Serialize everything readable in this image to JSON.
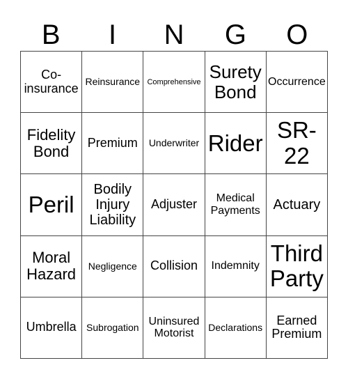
{
  "header": [
    "B",
    "I",
    "N",
    "G",
    "O"
  ],
  "cells": [
    [
      "Co-insurance",
      "Reinsurance",
      "Comprehensive",
      "Surety Bond",
      "Occurrence"
    ],
    [
      "Fidelity Bond",
      "Premium",
      "Underwriter",
      "Rider",
      "SR-22"
    ],
    [
      "Peril",
      "Bodily Injury Liability",
      "Adjuster",
      "Medical Payments",
      "Actuary"
    ],
    [
      "Moral Hazard",
      "Negligence",
      "Collision",
      "Indemnity",
      "Third Party"
    ],
    [
      "Umbrella",
      "Subrogation",
      "Uninsured Motorist",
      "Declarations",
      "Earned Premium"
    ]
  ]
}
